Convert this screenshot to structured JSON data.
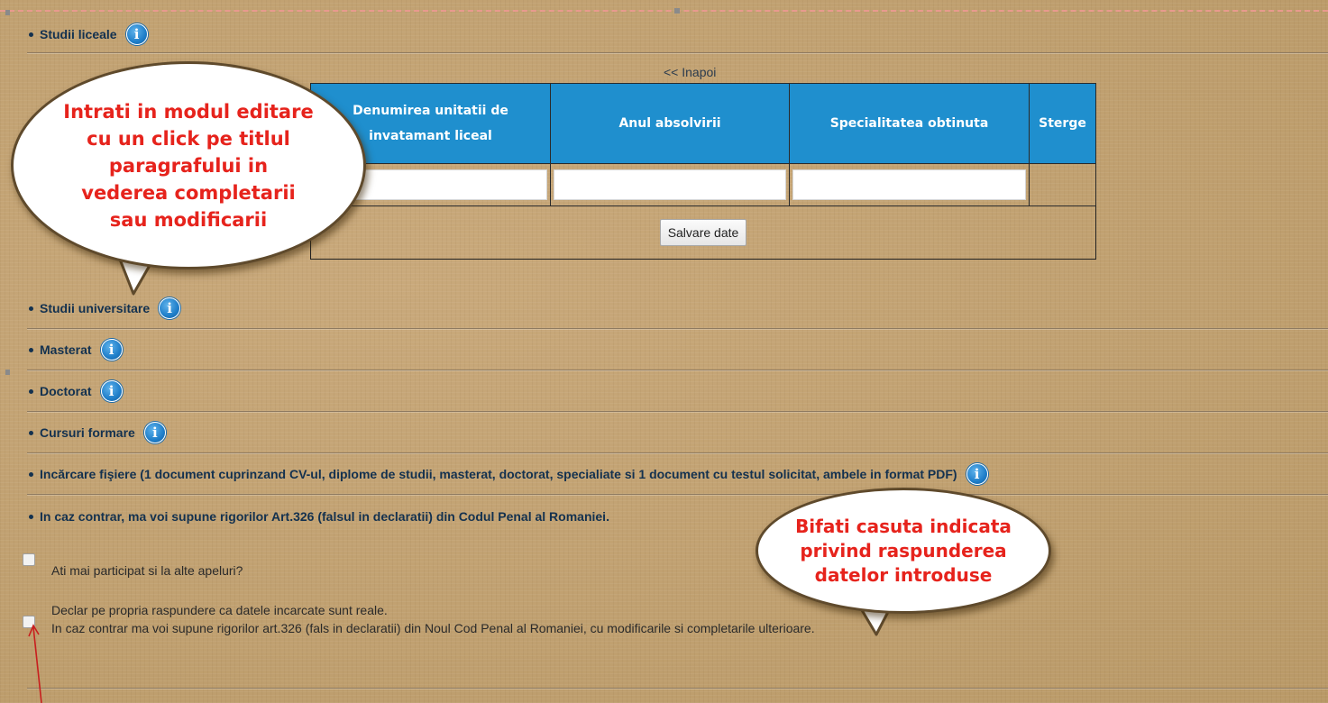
{
  "sections": {
    "studii_liceale": "Studii liceale",
    "studii_universitare": "Studii universitare",
    "masterat": "Masterat",
    "doctorat": "Doctorat",
    "cursuri_formare": "Cursuri formare",
    "incarcare_fisiere": "Incărcare fişiere (1 document cuprinzand CV-ul, diplome de studii, masterat, doctorat, specialiate si 1 document cu testul solicitat, ambele in format PDF)",
    "in_caz_contrar": "In caz contrar, ma voi supune rigorilor Art.326 (falsul in declaratii) din Codul Penal al Romaniei."
  },
  "info_icon_glyph": "i",
  "back_link": "<< Inapoi",
  "table": {
    "headers": [
      "Denumirea unitatii de invatamant liceal",
      "Anul absolvirii",
      "Specialitatea obtinuta",
      "Sterge"
    ],
    "rows": [
      [
        "",
        "",
        ""
      ]
    ]
  },
  "save_button": "Salvare date",
  "checkboxes": {
    "participat": "Ati mai participat si la alte apeluri?",
    "declar_line1": "Declar pe propria raspundere ca datele incarcate sunt reale.",
    "declar_line2": "In caz contrar ma voi supune rigorilor art.326 (fals in declaratii) din Noul Cod Penal al Romaniei, cu modificarile si completarile ulterioare."
  },
  "callouts": {
    "edit_mode": [
      "Intrati in modul editare",
      "cu un click pe titlul",
      "paragrafului in",
      "vederea completarii",
      "sau modificarii"
    ],
    "check_box": [
      "Bifati casuta indicata",
      "privind raspunderea",
      "datelor introduse"
    ]
  },
  "colors": {
    "background": "#c3a273",
    "header_blue": "#1f8fce",
    "callout_red": "#e6231c",
    "section_text": "#13314f"
  }
}
